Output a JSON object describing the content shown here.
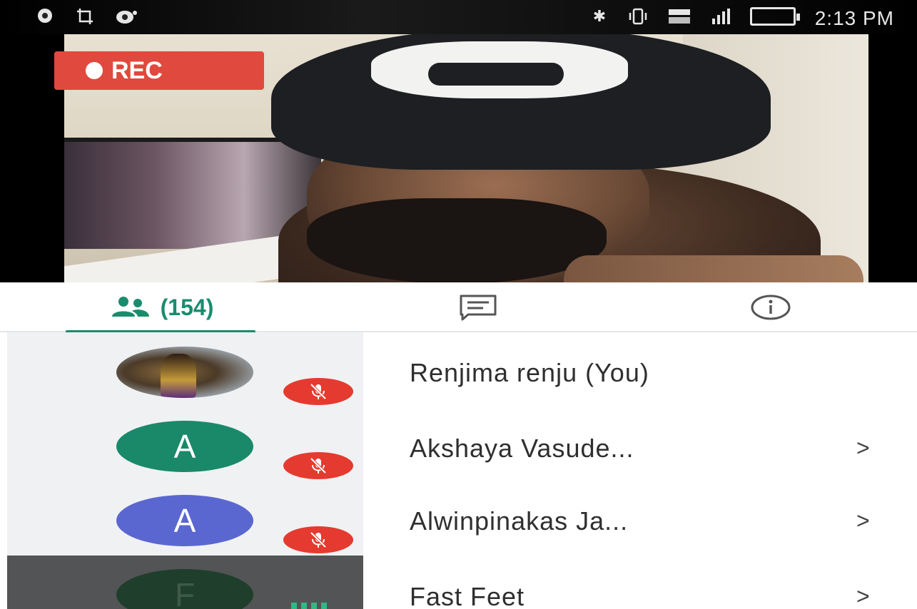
{
  "status_bar": {
    "time": "2:13 PM",
    "icons": [
      "chat-bubble-icon",
      "crop-icon",
      "notification-icon",
      "bluetooth-icon",
      "vibrate-icon",
      "volte-icon",
      "signal-icon",
      "battery-icon"
    ]
  },
  "recording": {
    "label": "REC"
  },
  "tabs": {
    "people_count": "(154)",
    "people_icon": "people-icon",
    "chat_icon": "chat-icon",
    "info_icon": "info-icon"
  },
  "participants": [
    {
      "name": "Renjima renju (You)",
      "avatar": "photo",
      "muted": true,
      "has_chevron": false
    },
    {
      "name": "Akshaya Vasude...",
      "avatar_letter": "A",
      "avatar_color": "#19896a",
      "muted": true,
      "has_chevron": true,
      "chevron": ">"
    },
    {
      "name": "Alwinpinakas Ja...",
      "avatar_letter": "A",
      "avatar_color": "#5b67d0",
      "muted": true,
      "has_chevron": true,
      "chevron": ">"
    },
    {
      "name": "Fast Feet",
      "avatar_letter": "F",
      "avatar_color": "#1f3f2c",
      "muted": false,
      "speaking": true,
      "has_chevron": true,
      "chevron": ">"
    }
  ],
  "colors": {
    "accent": "#1a8c6e",
    "rec_red": "#e0493d",
    "mute_red": "#e53a2f"
  }
}
